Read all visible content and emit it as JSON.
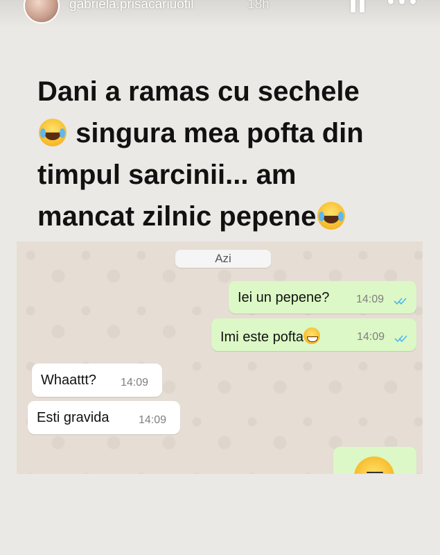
{
  "header": {
    "username": "gabriela.prisacariuotil",
    "time": "18h",
    "icons": [
      "pause-icon",
      "more-icon"
    ]
  },
  "story": {
    "caption": "Dani a ramas cu sechele\n singura mea pofta din\ntimpul sarcinii... am\nmancat zilnic pepene",
    "emoji": "laughing-tears-emoji"
  },
  "chat": {
    "date_label": "Azi",
    "messages": [
      {
        "direction": "out",
        "text": "Iei un pepene?",
        "time": "14:09",
        "status": "read"
      },
      {
        "direction": "out",
        "text": "Imi este pofta",
        "time": "14:09",
        "status": "read",
        "emoji": "grinning-emoji"
      },
      {
        "direction": "in",
        "text": "Whaattt?",
        "time": "14:09"
      },
      {
        "direction": "in",
        "text": "Esti gravida",
        "time": "14:09"
      }
    ]
  },
  "colors": {
    "outgoing_bubble": "#dcf8c6",
    "incoming_bubble": "#ffffff",
    "chat_background": "#e6ddd4",
    "read_ticks": "#4fb6ec"
  }
}
